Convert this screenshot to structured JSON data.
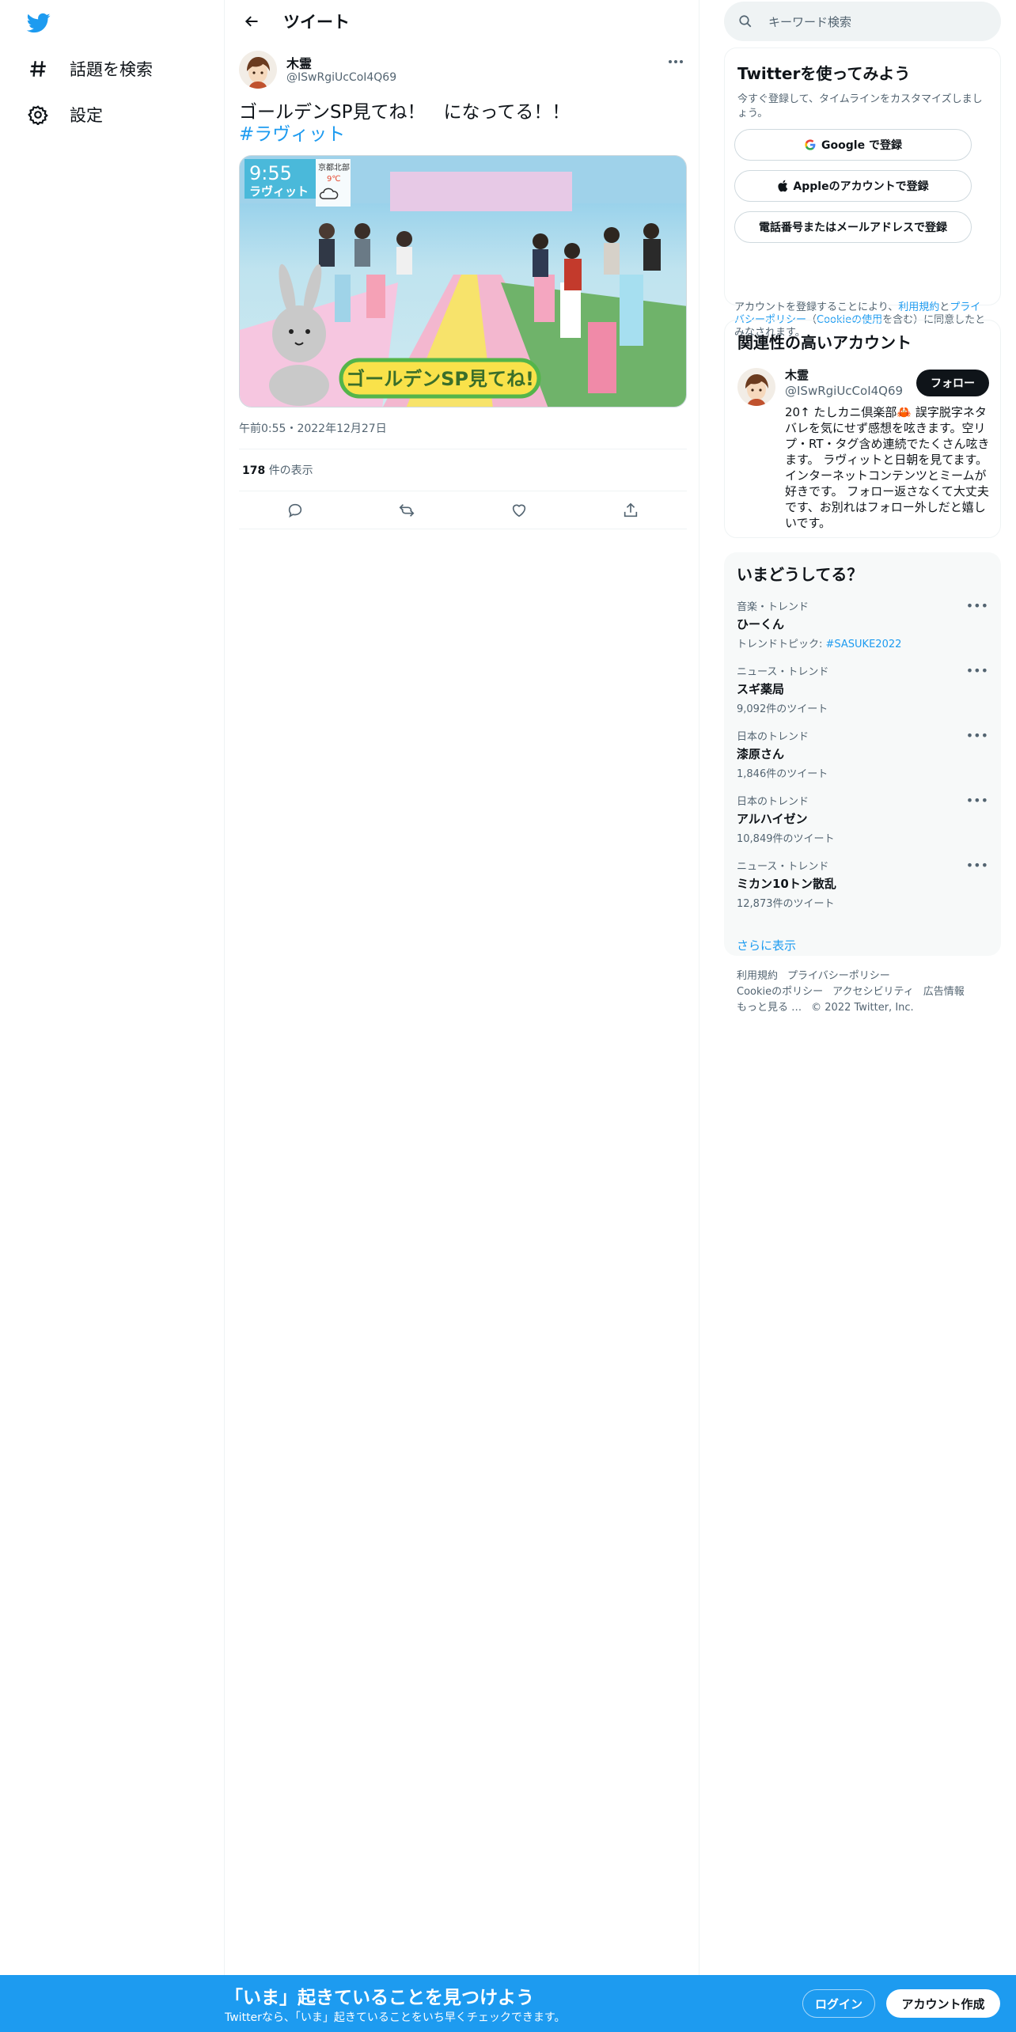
{
  "nav": {
    "items": [
      {
        "label": "話題を検索",
        "icon": "hashtag-icon"
      },
      {
        "label": "設定",
        "icon": "gear-icon"
      }
    ]
  },
  "main": {
    "header_title": "ツイート",
    "author": {
      "name": "木霊",
      "handle": "@ISwRgiUcCoI4Q69"
    },
    "tweet_text": "ゴールデンSP見てね！　になってる！！",
    "hashtag": "#ラヴィット",
    "media": {
      "clock": "9:55",
      "show_label": "ラヴィット",
      "weather_region": "京都北部",
      "weather_temp": "9℃",
      "banner": "ゴールデンSP見てね!"
    },
    "timestamp": "午前0:55・2022年12月27日",
    "views_count": "178",
    "views_label": "件の表示"
  },
  "right": {
    "search_placeholder": "キーワード検索",
    "signup": {
      "title": "Twitterを使ってみよう",
      "desc": "今すぐ登録して、タイムラインをカスタマイズしましょう。",
      "google": "Google で登録",
      "apple": "Appleのアカウントで登録",
      "phone": "電話番号またはメールアドレスで登録",
      "legal_prefix": "アカウントを登録することにより、",
      "legal_terms": "利用規約",
      "legal_and": "と",
      "legal_privacy": "プライバシーポリシー",
      "legal_open": "（",
      "legal_cookie": "Cookieの使用",
      "legal_suffix": "を含む）に同意したとみなされます。"
    },
    "related": {
      "title": "関連性の高いアカウント",
      "name": "木霊",
      "handle": "@ISwRgiUcCoI4Q69",
      "follow": "フォロー",
      "bio": "20↑ たしカニ倶楽部🦀 誤字脱字ネタバレを気にせず感想を呟きます。空リプ・RT・タグ含め連続でたくさん呟きます。 ラヴィットと日朝を見てます。インターネットコンテンツとミームが好きです。 フォロー返さなくて大丈夫です、お別れはフォロー外しだと嬉しいです。"
    },
    "trends": {
      "title": "いまどうしてる？",
      "items": [
        {
          "meta": "音楽・トレンド",
          "name": "ひーくん",
          "extra_prefix": "トレンドトピック: ",
          "extra_link": "#SASUKE2022"
        },
        {
          "meta": "ニュース・トレンド",
          "name": "スギ薬局",
          "count": "9,092件のツイート"
        },
        {
          "meta": "日本のトレンド",
          "name": "漆原さん",
          "count": "1,846件のツイート"
        },
        {
          "meta": "日本のトレンド",
          "name": "アルハイゼン",
          "count": "10,849件のツイート"
        },
        {
          "meta": "ニュース・トレンド",
          "name": "ミカン10トン散乱",
          "count": "12,873件のツイート"
        }
      ],
      "show_more": "さらに表示"
    },
    "footer": {
      "terms": "利用規約",
      "privacy": "プライバシーポリシー",
      "cookie": "Cookieのポリシー",
      "accessibility": "アクセシビリティ",
      "ads": "広告情報",
      "more": "もっと見る …",
      "copyright": "© 2022 Twitter, Inc."
    }
  },
  "bottom_bar": {
    "title": "「いま」起きていることを見つけよう",
    "subtitle": "Twitterなら、「いま」起きていることをいち早くチェックできます。",
    "login": "ログイン",
    "signup": "アカウント作成"
  },
  "colors": {
    "accent": "#1d9bf0",
    "text": "#0f1419",
    "muted": "#536471",
    "border": "#eff3f4"
  }
}
